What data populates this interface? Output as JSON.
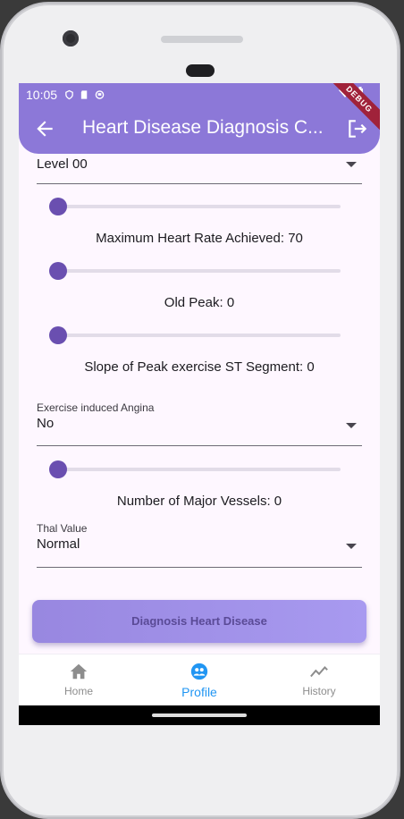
{
  "status_bar": {
    "time": "10:05",
    "debug_banner": "DEBUG"
  },
  "app_bar": {
    "title": "Heart Disease Diagnosis C...",
    "back_icon": "arrow-back-icon",
    "logout_icon": "logout-icon"
  },
  "form": {
    "top_dropdown": {
      "value": "Level 00"
    },
    "sliders": [
      {
        "label": "",
        "value": 0
      },
      {
        "label": "Maximum Heart Rate Achieved: 70",
        "value": 0
      },
      {
        "label": "Old Peak: 0",
        "value": 0
      },
      {
        "label": "Slope of Peak exercise ST Segment: 0",
        "value": 0
      }
    ],
    "angina_dropdown": {
      "label": "Exercise induced Angina",
      "value": "No"
    },
    "vessels_slider": {
      "label": "Number of Major Vessels: 0",
      "value": 0
    },
    "thal_dropdown": {
      "label": "Thal Value",
      "value": "Normal"
    },
    "submit_label": "Diagnosis Heart Disease"
  },
  "bottom_nav": {
    "items": [
      {
        "label": "Home",
        "icon": "home-icon",
        "active": false
      },
      {
        "label": "Profile",
        "icon": "profile-icon",
        "active": true
      },
      {
        "label": "History",
        "icon": "history-icon",
        "active": false
      }
    ]
  },
  "colors": {
    "accent": "#8c78d8",
    "slider_thumb": "#6a4fb0",
    "nav_active": "#2196f3"
  }
}
